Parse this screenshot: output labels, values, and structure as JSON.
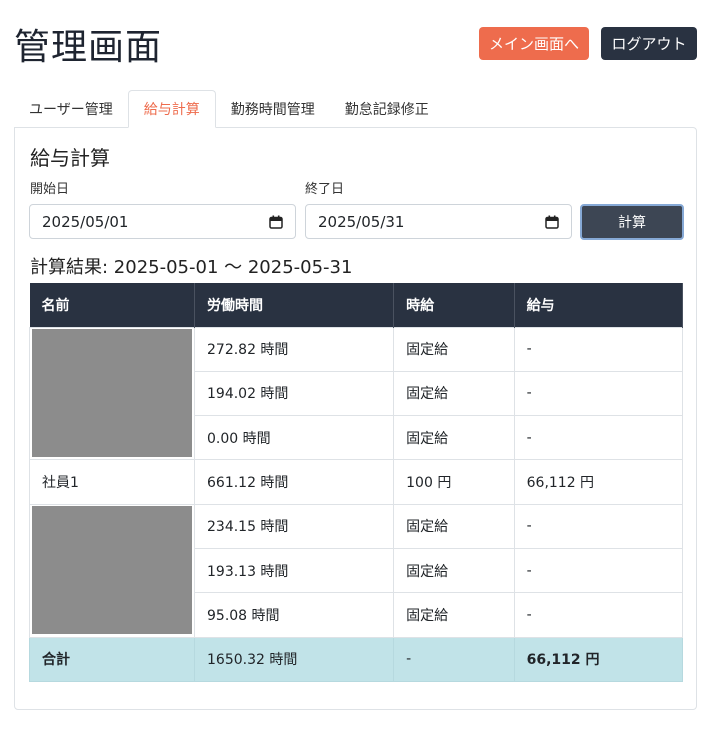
{
  "header": {
    "title": "管理画面",
    "main_button": "メイン画面へ",
    "logout_button": "ログアウト"
  },
  "tabs": [
    {
      "label": "ユーザー管理"
    },
    {
      "label": "給与計算"
    },
    {
      "label": "勤務時間管理"
    },
    {
      "label": "勤怠記録修正"
    }
  ],
  "form": {
    "title": "給与計算",
    "start_label": "開始日",
    "start_value": "2025/05/01",
    "end_label": "終了日",
    "end_value": "2025/05/31",
    "calc_button": "計算"
  },
  "result": {
    "title": "計算結果: 2025-05-01 〜 2025-05-31",
    "columns": [
      "名前",
      "労働時間",
      "時給",
      "給与"
    ],
    "rows": [
      {
        "name": "",
        "hours": "272.82 時間",
        "rate": "固定給",
        "pay": "-"
      },
      {
        "name": "",
        "hours": "194.02 時間",
        "rate": "固定給",
        "pay": "-"
      },
      {
        "name": "",
        "hours": "0.00 時間",
        "rate": "固定給",
        "pay": "-"
      },
      {
        "name": "社員1",
        "hours": "661.12 時間",
        "rate": "100 円",
        "pay": "66,112 円"
      },
      {
        "name": "",
        "hours": "234.15 時間",
        "rate": "固定給",
        "pay": "-"
      },
      {
        "name": "",
        "hours": "193.13 時間",
        "rate": "固定給",
        "pay": "-"
      },
      {
        "name": "",
        "hours": "95.08 時間",
        "rate": "固定給",
        "pay": "-"
      }
    ],
    "total": {
      "name": "合計",
      "hours": "1650.32 時間",
      "rate": "-",
      "pay": "66,112 円"
    }
  },
  "colors": {
    "accent": "#ee6c4d",
    "dark": "#293241",
    "total_row": "#c1e3e8"
  }
}
